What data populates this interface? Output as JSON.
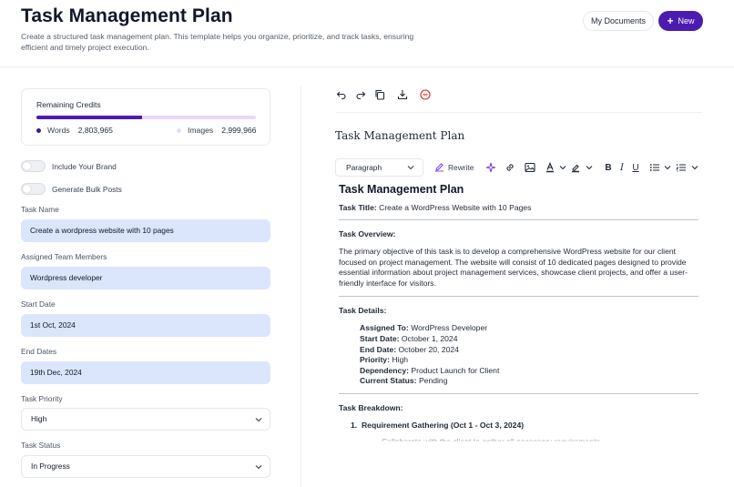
{
  "header": {
    "title": "Task Management Plan",
    "description": "Create a structured task management plan. This template helps you organize, prioritize, and track tasks, ensuring efficient and timely project execution.",
    "my_documents_label": "My Documents",
    "new_label": "New"
  },
  "credits": {
    "title": "Remaining Credits",
    "progress_fraction": 0.48,
    "words_label": "Words",
    "words_value": "2,803,965",
    "images_label": "Images",
    "images_value": "2,999,966",
    "colors": {
      "fill": "#4c1bb0",
      "track": "#e8d8fb"
    }
  },
  "toggles": {
    "include_brand": {
      "label": "Include Your Brand",
      "on": false
    },
    "bulk_posts": {
      "label": "Generate Bulk Posts",
      "on": false
    }
  },
  "form": {
    "task_name": {
      "label": "Task Name",
      "value": "Create a wordpress website with 10 pages"
    },
    "team_members": {
      "label": "Assigned Team Members",
      "value": "Wordpress developer"
    },
    "start_date": {
      "label": "Start Date",
      "value": "1st Oct, 2024"
    },
    "end_dates": {
      "label": "End Dates",
      "value": "19th Dec, 2024"
    },
    "priority": {
      "label": "Task Priority",
      "value": "High"
    },
    "status": {
      "label": "Task Status",
      "value": "In Progress"
    }
  },
  "document": {
    "title": "Task Management Plan",
    "toolbar": {
      "paragraph_label": "Paragraph",
      "rewrite_label": "Rewrite"
    },
    "content": {
      "heading": "Task Management Plan",
      "task_title_label": "Task Title:",
      "task_title_value": "Create a WordPress Website with 10 Pages",
      "overview_heading": "Task Overview:",
      "overview_text": "The primary objective of this task is to develop a comprehensive WordPress website for our client focused on project management. The website will consist of 10 dedicated pages designed to provide essential information about project management services, showcase client projects, and offer a user-friendly interface for visitors.",
      "details_heading": "Task Details:",
      "details": [
        {
          "label": "Assigned To:",
          "value": "WordPress Developer"
        },
        {
          "label": "Start Date:",
          "value": "October 1, 2024"
        },
        {
          "label": "End Date:",
          "value": "October 20, 2024"
        },
        {
          "label": "Priority:",
          "value": "High"
        },
        {
          "label": "Dependency:",
          "value": "Product Launch for Client"
        },
        {
          "label": "Current Status:",
          "value": "Pending"
        }
      ],
      "breakdown_heading": "Task Breakdown:",
      "breakdown_item_1": "Requirement Gathering (Oct 1 - Oct 3, 2024)",
      "breakdown_number_1": "1.",
      "partial_text": "Collaborate with the client to gather all necessary requirements"
    }
  }
}
